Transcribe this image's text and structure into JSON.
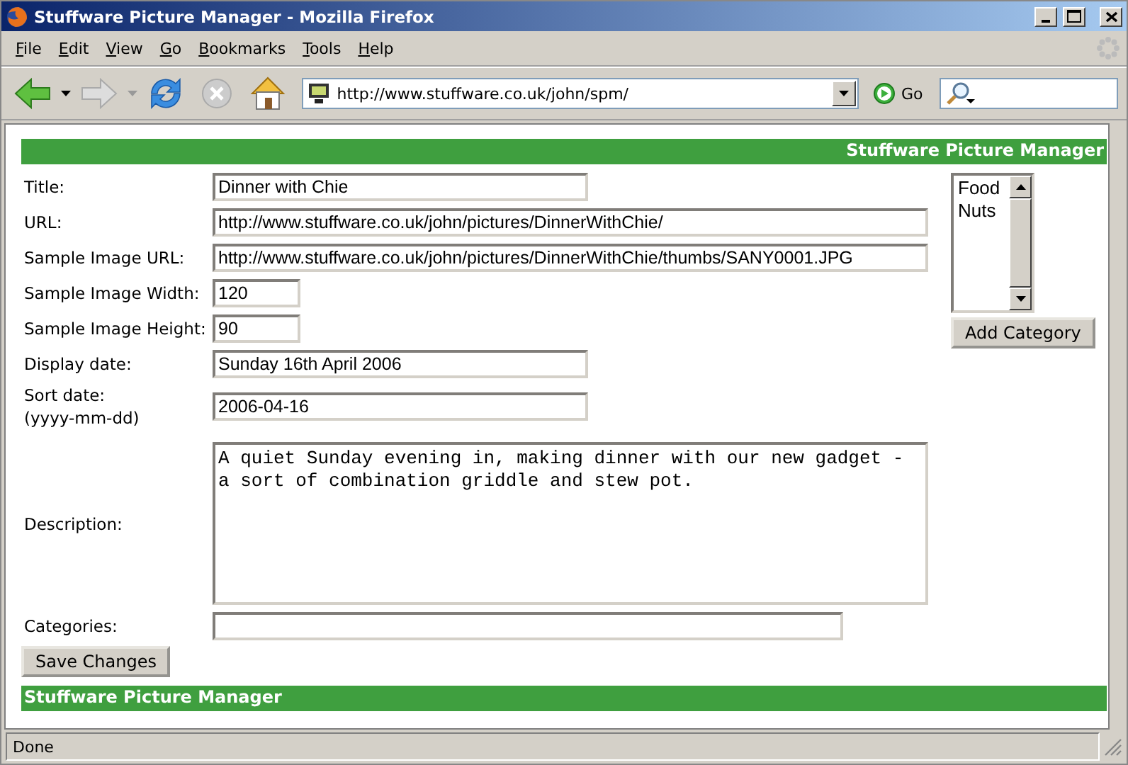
{
  "window": {
    "title": "Stuffware Picture Manager - Mozilla Firefox"
  },
  "menu": [
    "File",
    "Edit",
    "View",
    "Go",
    "Bookmarks",
    "Tools",
    "Help"
  ],
  "toolbar": {
    "address": "http://www.stuffware.co.uk/john/spm/",
    "go_label": "Go"
  },
  "header": {
    "title": "Stuffware Picture Manager"
  },
  "fields": [
    {
      "label": "Title:",
      "value": "Dinner with Chie",
      "kind": "medium"
    },
    {
      "label": "URL:",
      "value": "http://www.stuffware.co.uk/john/pictures/DinnerWithChie/",
      "kind": "long"
    },
    {
      "label": "Sample Image URL:",
      "value": "http://www.stuffware.co.uk/john/pictures/DinnerWithChie/thumbs/SANY0001.JPG",
      "kind": "long"
    },
    {
      "label": "Sample Image Width:",
      "value": "120",
      "kind": "short"
    },
    {
      "label": "Sample Image Height:",
      "value": "90",
      "kind": "short"
    },
    {
      "label": "Display date:",
      "value": "Sunday 16th April 2006",
      "kind": "medium"
    },
    {
      "label": "Sort date:",
      "hint": "(yyyy-mm-dd)",
      "value": "2006-04-16",
      "kind": "medium"
    },
    {
      "label": "Description:",
      "value": "A quiet Sunday evening in, making dinner with our new gadget - a sort of combination griddle and stew pot.",
      "kind": "textarea"
    },
    {
      "label": "Categories:",
      "kind": "wide"
    }
  ],
  "category_list": {
    "options": [
      {
        "label": "Food",
        "selected": false
      },
      {
        "label": "Nuts",
        "selected": false
      }
    ],
    "button": "Add Category"
  },
  "save_button": "Save Changes",
  "footer": {
    "title": "Stuffware Picture Manager"
  },
  "status_bar": {
    "text": "Done"
  }
}
